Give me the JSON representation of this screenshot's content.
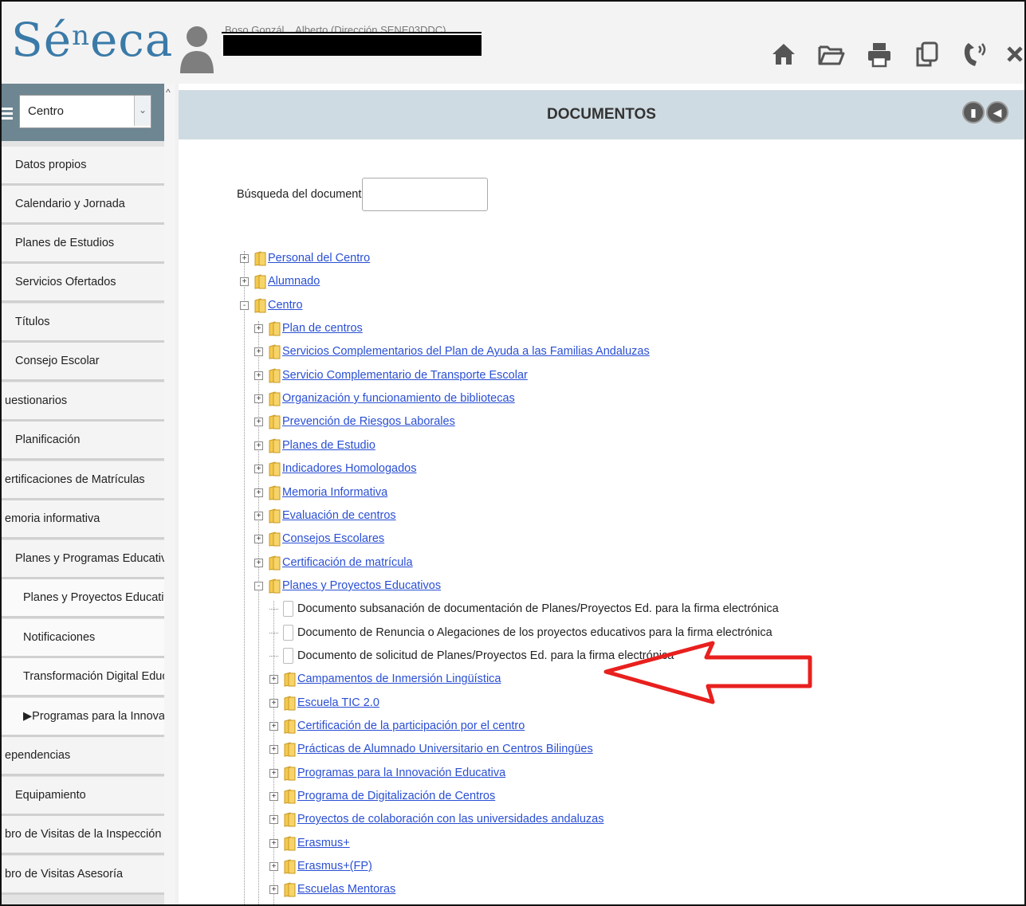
{
  "header": {
    "logo_main": "Sé",
    "logo_sup": "n",
    "logo_rest": "eca",
    "user_name": "Boso Gonzál... Alberto (Dirección SENE03DDC)",
    "icons": [
      "home-icon",
      "folder-open-icon",
      "print-icon",
      "copy-icon",
      "phone-icon",
      "close-icon"
    ]
  },
  "sidebar": {
    "select_value": "Centro",
    "items": [
      {
        "label": "Datos propios",
        "sub": false
      },
      {
        "label": "Calendario y Jornada",
        "sub": false
      },
      {
        "label": "Planes de Estudios",
        "sub": false
      },
      {
        "label": "Servicios Ofertados",
        "sub": false
      },
      {
        "label": "Títulos",
        "sub": false
      },
      {
        "label": "Consejo Escolar",
        "sub": false
      },
      {
        "label": "uestionarios",
        "sub": false
      },
      {
        "label": "Planificación",
        "sub": false
      },
      {
        "label": "ertificaciones de Matrículas",
        "sub": false
      },
      {
        "label": "emoria informativa",
        "sub": false
      },
      {
        "label": "Planes y Programas Educativos",
        "sub": false
      },
      {
        "label": "Planes y Proyectos Educativos",
        "sub": true
      },
      {
        "label": "Notificaciones",
        "sub": true
      },
      {
        "label": "Transformación Digital Educat",
        "sub": true
      },
      {
        "label": "▶Programas para la Innovación",
        "sub": true
      },
      {
        "label": "ependencias",
        "sub": false
      },
      {
        "label": "Equipamiento",
        "sub": false
      },
      {
        "label": "bro de Visitas de la Inspección",
        "sub": false
      },
      {
        "label": "bro de Visitas Asesoría",
        "sub": false
      }
    ]
  },
  "main": {
    "title": "DOCUMENTOS",
    "search_label": "Búsqueda del documento:",
    "search_value": "",
    "tree": [
      {
        "label": "Personal del Centro",
        "level": 0,
        "toggle": "+",
        "type": "folder"
      },
      {
        "label": "Alumnado",
        "level": 0,
        "toggle": "+",
        "type": "folder"
      },
      {
        "label": "Centro",
        "level": 0,
        "toggle": "-",
        "type": "folder"
      },
      {
        "label": "Plan de centros",
        "level": 1,
        "toggle": "+",
        "type": "folder"
      },
      {
        "label": "Servicios Complementarios del Plan de Ayuda a las Familias Andaluzas",
        "level": 1,
        "toggle": "+",
        "type": "folder"
      },
      {
        "label": "Servicio Complementario de Transporte Escolar",
        "level": 1,
        "toggle": "+",
        "type": "folder"
      },
      {
        "label": "Organización y funcionamiento de bibliotecas",
        "level": 1,
        "toggle": "+",
        "type": "folder"
      },
      {
        "label": "Prevención de Riesgos Laborales",
        "level": 1,
        "toggle": "+",
        "type": "folder"
      },
      {
        "label": "Planes de Estudio",
        "level": 1,
        "toggle": "+",
        "type": "folder"
      },
      {
        "label": "Indicadores Homologados",
        "level": 1,
        "toggle": "+",
        "type": "folder"
      },
      {
        "label": "Memoria Informativa",
        "level": 1,
        "toggle": "+",
        "type": "folder"
      },
      {
        "label": "Evaluación de centros",
        "level": 1,
        "toggle": "+",
        "type": "folder"
      },
      {
        "label": "Consejos Escolares",
        "level": 1,
        "toggle": "+",
        "type": "folder"
      },
      {
        "label": "Certificación de matrícula",
        "level": 1,
        "toggle": "+",
        "type": "folder"
      },
      {
        "label": "Planes y Proyectos Educativos",
        "level": 1,
        "toggle": "-",
        "type": "folder"
      },
      {
        "label": "Documento subsanación de documentación de Planes/Proyectos Ed. para la firma electrónica",
        "level": 2,
        "toggle": "",
        "type": "doc"
      },
      {
        "label": "Documento de Renuncia o Alegaciones de los proyectos educativos para la firma electrónica",
        "level": 2,
        "toggle": "",
        "type": "doc"
      },
      {
        "label": "Documento de solicitud de Planes/Proyectos Ed. para la firma electrónica",
        "level": 2,
        "toggle": "",
        "type": "doc"
      },
      {
        "label": "Campamentos de Inmersión Lingüística",
        "level": 2,
        "toggle": "+",
        "type": "folder"
      },
      {
        "label": "Escuela TIC 2.0",
        "level": 2,
        "toggle": "+",
        "type": "folder"
      },
      {
        "label": "Certificación de la participación por el centro",
        "level": 2,
        "toggle": "+",
        "type": "folder"
      },
      {
        "label": "Prácticas de Alumnado Universitario en Centros Bilingües",
        "level": 2,
        "toggle": "+",
        "type": "folder"
      },
      {
        "label": "Programas para la Innovación Educativa",
        "level": 2,
        "toggle": "+",
        "type": "folder"
      },
      {
        "label": "Programa de Digitalización de Centros",
        "level": 2,
        "toggle": "+",
        "type": "folder"
      },
      {
        "label": "Proyectos de colaboración con las universidades andaluzas",
        "level": 2,
        "toggle": "+",
        "type": "folder"
      },
      {
        "label": "Erasmus+",
        "level": 2,
        "toggle": "+",
        "type": "folder"
      },
      {
        "label": "Erasmus+(FP)",
        "level": 2,
        "toggle": "+",
        "type": "folder"
      },
      {
        "label": "Escuelas Mentoras",
        "level": 2,
        "toggle": "+",
        "type": "folder"
      }
    ]
  },
  "colors": {
    "accent": "#3a7aa8",
    "link": "#2a4fd4",
    "annotation_arrow": "#e8201e",
    "titlebar": "#cfdbe2",
    "sidebar_head": "#6d8692"
  }
}
